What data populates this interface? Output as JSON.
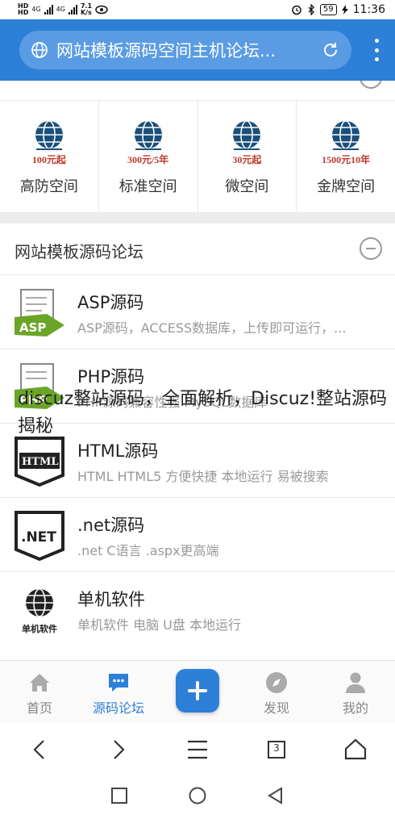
{
  "status_bar": {
    "carrier_top": "HD",
    "carrier_bottom": "HD",
    "net1": "4G",
    "net2": "4G",
    "speed": "7.1",
    "speed_unit": "K/s",
    "battery": "59",
    "time": "11:36"
  },
  "header": {
    "page_title": "网站模板源码空间主机论坛..."
  },
  "hosting_section": {
    "items": [
      {
        "label": "高防空间",
        "badge": "100元起"
      },
      {
        "label": "标准空间",
        "badge": "300元/5年"
      },
      {
        "label": "微空间",
        "badge": "30元起"
      },
      {
        "label": "金牌空间",
        "badge": "1500元10年"
      }
    ]
  },
  "forum_section": {
    "title": "网站模板源码论坛",
    "items": [
      {
        "title": "ASP源码",
        "desc": "ASP源码，ACCESS数据库，上传即可运行，...",
        "thumb_text": "ASP"
      },
      {
        "title": "PHP源码",
        "desc": "PHP源码兼容性强 MySQL数据库",
        "thumb_text": "PHP"
      },
      {
        "title": "HTML源码",
        "desc": "HTML HTML5 方便快捷 本地运行 易被搜索",
        "thumb_text": "HTML"
      },
      {
        "title": ".net源码",
        "desc": ".net C语言 .aspx更高端",
        "thumb_text": ".NET"
      },
      {
        "title": "单机软件",
        "desc": "单机软件 电脑 U盘 本地运行",
        "thumb_text": "单机软件"
      }
    ]
  },
  "overlay_text": "discuz整站源码，全面解析，Discuz!整站源码揭秘",
  "tabbar": {
    "items": [
      {
        "label": "首页",
        "icon": "home-icon"
      },
      {
        "label": "源码论坛",
        "icon": "chat-icon"
      },
      {
        "label": "发现",
        "icon": "compass-icon"
      },
      {
        "label": "我的",
        "icon": "person-icon"
      }
    ]
  },
  "browser_nav": {
    "tab_count": "3"
  },
  "colors": {
    "accent": "#2e7fd8",
    "header_bar": "#5a9ce3",
    "badge_red": "#c0392b"
  }
}
